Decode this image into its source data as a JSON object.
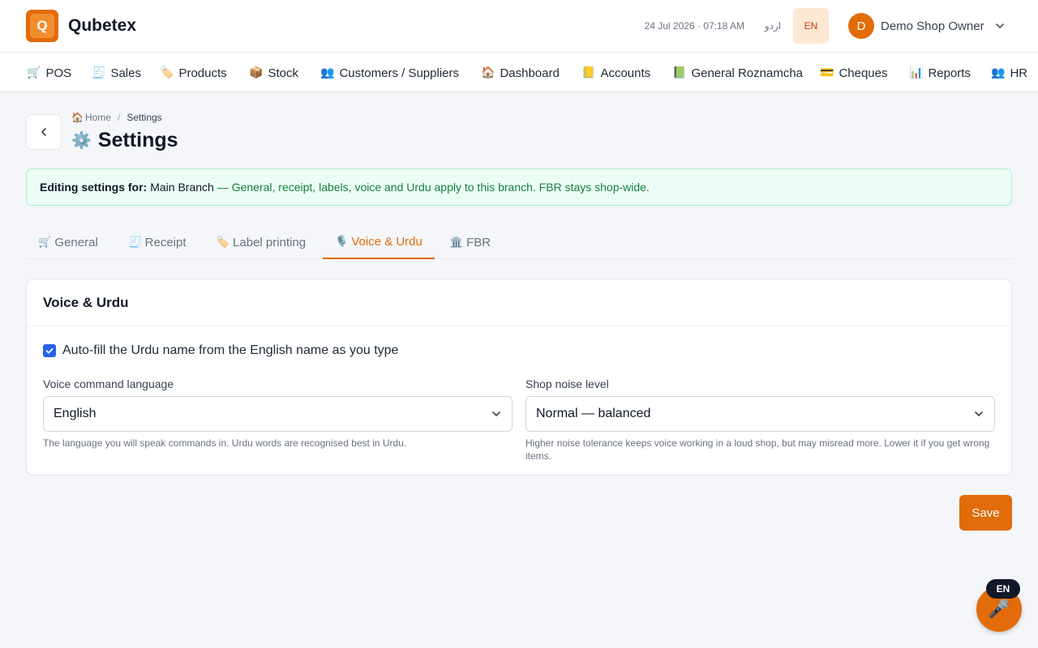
{
  "header": {
    "brand": "Qubetex",
    "logo_letter": "Q",
    "datetime": "24 Jul 2026 · 07:18 AM",
    "lang_urdu": "اردو",
    "lang_en": "EN",
    "user_initial": "D",
    "user_name": "Demo Shop Owner"
  },
  "nav": {
    "items": [
      {
        "label": "POS",
        "icon": "🛒"
      },
      {
        "label": "Sales",
        "icon": "🧾"
      },
      {
        "label": "Products",
        "icon": "🏷️"
      },
      {
        "label": "Stock",
        "icon": "📦"
      },
      {
        "label": "Customers / Suppliers",
        "icon": "👥"
      },
      {
        "label": "Dashboard",
        "icon": "🏠"
      },
      {
        "label": "Accounts",
        "icon": "📒"
      },
      {
        "label": "General Roznamcha",
        "icon": "📗"
      },
      {
        "label": "Cheques",
        "icon": "💳"
      },
      {
        "label": "Reports",
        "icon": "📊"
      },
      {
        "label": "HR",
        "icon": "👥"
      }
    ]
  },
  "breadcrumb": {
    "home": "Home",
    "home_icon": "🏠",
    "separator": "/",
    "current": "Settings"
  },
  "page": {
    "title": "Settings",
    "title_icon": "⚙️"
  },
  "banner": {
    "label": "Editing settings for:",
    "branch": "Main Branch",
    "rest": "— General, receipt, labels, voice and Urdu apply to this branch. FBR stays shop-wide."
  },
  "tabs": [
    {
      "label": "General",
      "icon": "🛒"
    },
    {
      "label": "Receipt",
      "icon": "🧾"
    },
    {
      "label": "Label printing",
      "icon": "🏷️"
    },
    {
      "label": "Voice & Urdu",
      "icon": "🎙️"
    },
    {
      "label": "FBR",
      "icon": "🏛️"
    }
  ],
  "card": {
    "title": "Voice & Urdu",
    "autofill_label": "Auto-fill the Urdu name from the English name as you type",
    "voice_language": {
      "label": "Voice command language",
      "value": "English",
      "hint": "The language you will speak commands in. Urdu words are recognised best in Urdu."
    },
    "noise_level": {
      "label": "Shop noise level",
      "value": "Normal — balanced",
      "hint": "Higher noise tolerance keeps voice working in a loud shop, but may misread more. Lower it if you get wrong items."
    }
  },
  "actions": {
    "save_label": "Save"
  },
  "voice_fab": {
    "badge": "EN",
    "icon": "🎤"
  },
  "colors": {
    "accent": "#e26b0a",
    "checkbox": "#2563eb",
    "banner_bg": "#ecfdf5",
    "banner_text": "#15803d"
  }
}
